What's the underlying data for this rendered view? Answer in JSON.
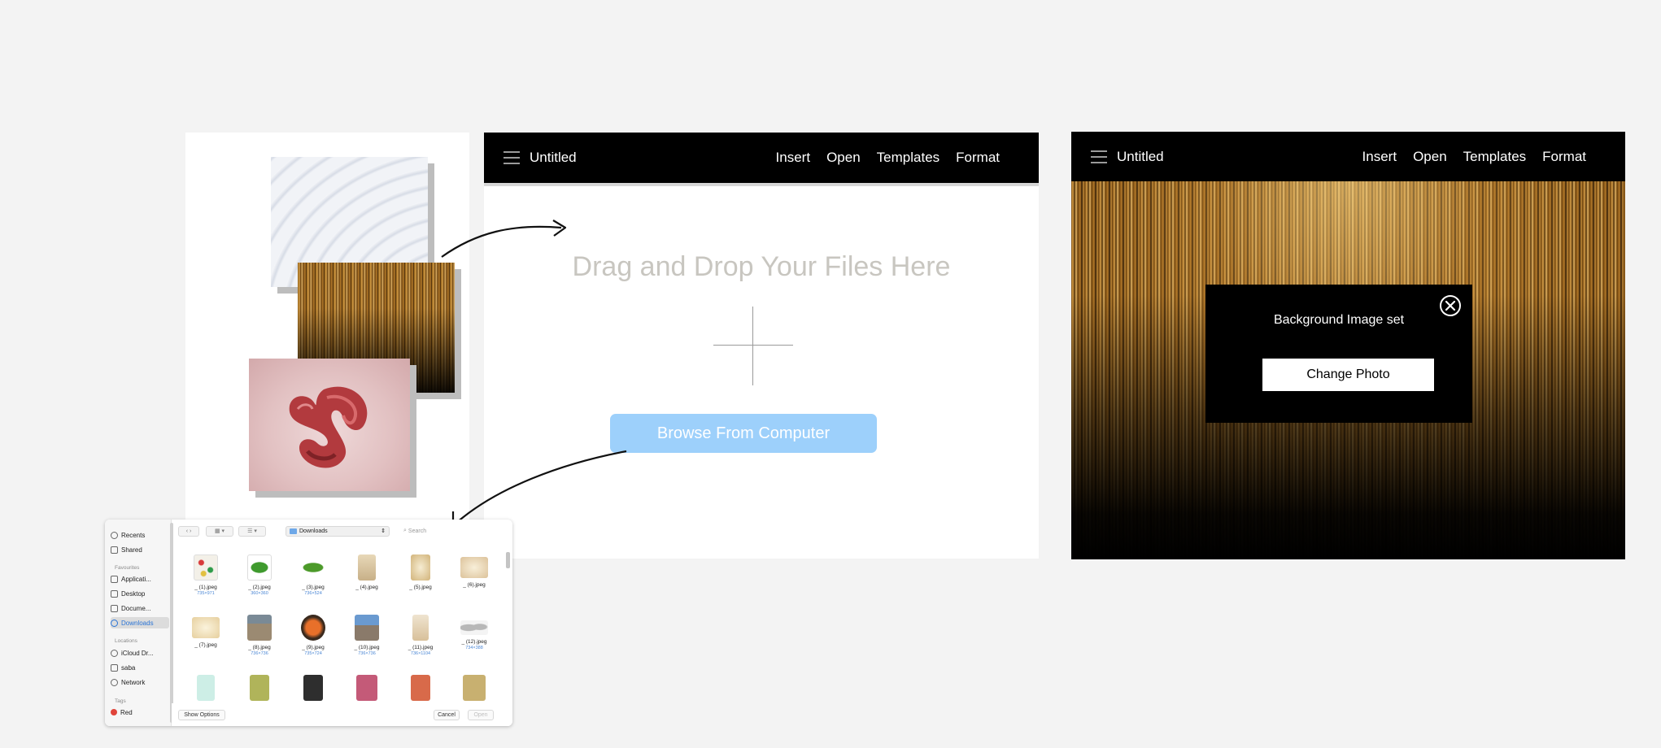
{
  "upload_panel": {
    "doc_title": "Untitled",
    "nav": [
      "Insert",
      "Open",
      "Templates",
      "Format"
    ],
    "drop_title": "Drag and Drop Your Files Here",
    "browse_label": "Browse From Computer"
  },
  "bg_panel": {
    "doc_title": "Untitled",
    "nav": [
      "Insert",
      "Open",
      "Templates",
      "Format"
    ],
    "modal_title": "Background Image set",
    "change_label": "Change Photo"
  },
  "finder": {
    "sidebar": {
      "items_top": [
        "Recents",
        "Shared"
      ],
      "favourites_header": "Favourites",
      "favourites": [
        "Applicati...",
        "Desktop",
        "Docume...",
        "Downloads"
      ],
      "locations_header": "Locations",
      "locations": [
        "iCloud Dr...",
        "saba",
        "Network"
      ],
      "tags_header": "Tags",
      "tags": [
        "Red"
      ]
    },
    "location": "Downloads",
    "search_placeholder": "Search",
    "files": [
      {
        "name": "_ (1).jpeg",
        "dim": "735×971"
      },
      {
        "name": "_ (2).jpeg",
        "dim": "360×360"
      },
      {
        "name": "_ (3).jpeg",
        "dim": "736×524"
      },
      {
        "name": "_ (4).jpeg",
        "dim": ""
      },
      {
        "name": "_ (5).jpeg",
        "dim": ""
      },
      {
        "name": "_ (6).jpeg",
        "dim": ""
      },
      {
        "name": "_ (7).jpeg",
        "dim": ""
      },
      {
        "name": "_ (8).jpeg",
        "dim": "736×736"
      },
      {
        "name": "_ (9).jpeg",
        "dim": "735×724"
      },
      {
        "name": "_ (10).jpeg",
        "dim": "736×736"
      },
      {
        "name": "_ (11).jpeg",
        "dim": "736×1104"
      },
      {
        "name": "_ (12).jpeg",
        "dim": "734×388"
      }
    ],
    "show_options": "Show Options",
    "cancel": "Cancel",
    "open": "Open"
  },
  "colors": {
    "browse_button": "#9dd0fb",
    "accent_blue": "#2a74d6",
    "tag_red": "#e0443a"
  }
}
